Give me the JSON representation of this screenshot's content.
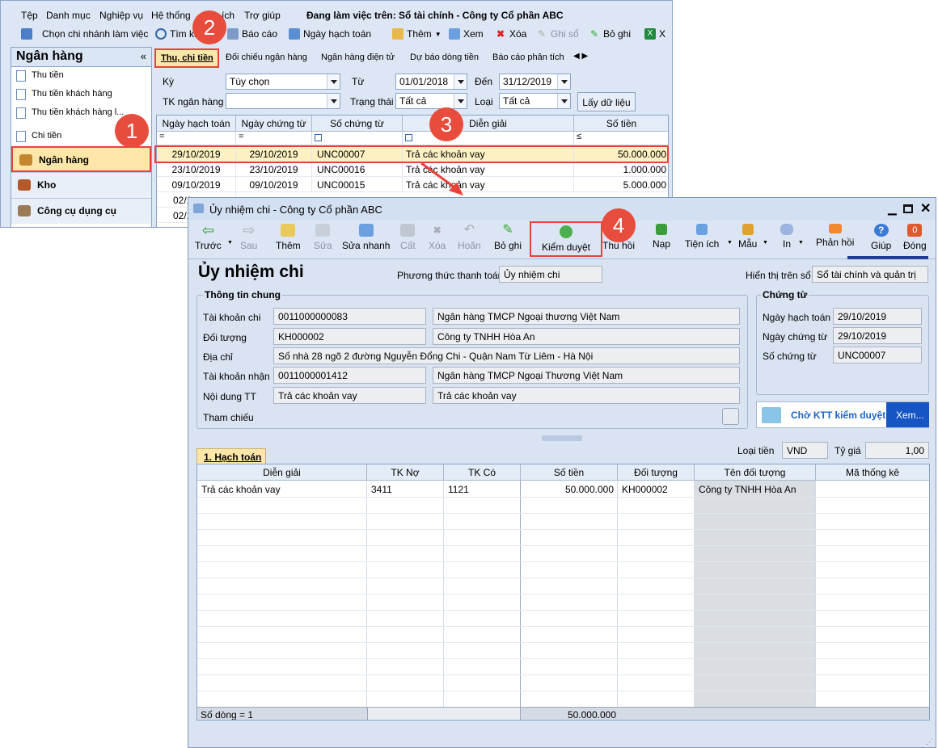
{
  "main": {
    "menu": [
      "Tệp",
      "Danh mục",
      "Nghiệp vụ",
      "Hệ thống",
      "ích",
      "Trợ giúp"
    ],
    "working_on": "Đang làm việc trên: Sổ tài chính - Công ty Cổ phần ABC",
    "toolbar": {
      "branch": "Chọn chi nhánh làm việc",
      "search": "Tìm ki",
      "report": "Báo cáo",
      "posting_date": "Ngày hạch toán",
      "add": "Thêm",
      "view": "Xem",
      "delete": "Xóa",
      "post_ledger": "Ghi sổ",
      "unpost": "Bỏ ghi",
      "excel": "X"
    },
    "left_panel": {
      "title": "Ngân hàng",
      "collapse": "«",
      "items": [
        "Thu tiền",
        "Thu tiền khách hàng",
        "Thu tiền khách hàng l...",
        "Chi tiền"
      ],
      "modules": [
        "Ngân hàng",
        "Kho",
        "Công cụ dụng cụ"
      ]
    },
    "tabs": [
      "Thu, chi tiền",
      "Đối chiếu ngân hàng",
      "Ngân hàng điện tử",
      "Dự báo dòng tiền",
      "Báo cáo phân tích"
    ],
    "filters": {
      "period_label": "Kỳ",
      "period_value": "Tùy chọn",
      "from_label": "Từ",
      "from_value": "01/01/2018",
      "to_label": "Đến",
      "to_value": "31/12/2019",
      "account_label": "TK ngân hàng",
      "account_value": "",
      "status_label": "Trạng thái",
      "status_value": "Tất cả",
      "type_label": "Loại",
      "type_value": "Tất cả",
      "fetch_button": "Lấy dữ liệu"
    },
    "grid": {
      "headers": [
        "Ngày hạch toán",
        "Ngày chứng từ",
        "Số chứng từ",
        "Diễn giải",
        "Số tiền"
      ],
      "filter_ops": [
        "=",
        "=",
        "",
        "",
        "≤"
      ],
      "rows": [
        [
          "29/10/2019",
          "29/10/2019",
          "UNC00007",
          "Trả các khoản vay",
          "50.000.000"
        ],
        [
          "23/10/2019",
          "23/10/2019",
          "UNC00016",
          "Trả các khoản vay",
          "1.000.000"
        ],
        [
          "09/10/2019",
          "09/10/2019",
          "UNC00015",
          "Trả các khoản vay",
          "5.000.000"
        ],
        [
          "02/1",
          "",
          "",
          "",
          ""
        ],
        [
          "02/1",
          "",
          "",
          "",
          ""
        ]
      ]
    }
  },
  "dialog": {
    "title": "Ủy nhiệm chi - Công ty Cổ phần ABC",
    "toolbar": [
      "Trước",
      "Sau",
      "Thêm",
      "Sửa",
      "Sửa nhanh",
      "Cất",
      "Xóa",
      "Hoãn",
      "Bỏ ghi",
      "Kiểm duyệt",
      "Thu hồi",
      "Nạp",
      "Tiện ích",
      "Mẫu",
      "In",
      "Phản hồi",
      "Giúp",
      "Đóng"
    ],
    "heading": "Ủy nhiệm chi",
    "payment_method_label": "Phương thức thanh toán",
    "payment_method_value": "Ủy nhiệm chi",
    "show_on_label": "Hiển thị trên sổ",
    "show_on_value": "Sổ tài chính và quản trị",
    "general_group": "Thông tin chung",
    "pay_account_label": "Tài khoản chi",
    "pay_account": "0011000000083",
    "pay_bank": "Ngân hàng TMCP Ngoại thương Việt Nam",
    "object_label": "Đối tượng",
    "object_code": "KH000002",
    "object_name": "Công ty TNHH Hòa An",
    "address_label": "Địa chỉ",
    "address": "Số nhà 28 ngõ 2 đường Nguyễn Đổng Chi - Quận Nam Từ Liêm - Hà Nội",
    "recv_account_label": "Tài khoản nhận",
    "recv_account": "0011000001412",
    "recv_bank": "Ngân hàng TMCP Ngoại Thương Việt Nam",
    "content_label": "Nội dung TT",
    "content": "Trả các khoản vay",
    "content2": "Trả các khoản vay",
    "reference_label": "Tham chiếu",
    "voucher_group": "Chứng từ",
    "posting_date_label": "Ngày hạch toán",
    "posting_date": "29/10/2019",
    "voucher_date_label": "Ngày chứng từ",
    "voucher_date": "29/10/2019",
    "voucher_no_label": "Số chứng từ",
    "voucher_no": "UNC00007",
    "approval_status": "Chờ KTT kiểm duyệt",
    "approval_view": "Xem...",
    "tab_accounting": "1. Hạch toán",
    "currency_label": "Loại tiền",
    "currency": "VND",
    "rate_label": "Tỷ giá",
    "rate": "1,00",
    "grid_headers": [
      "Diễn giải",
      "TK Nợ",
      "TK Có",
      "Số tiền",
      "Đối tượng",
      "Tên đối tượng",
      "Mã thống kê"
    ],
    "grid_row": [
      "Trả các khoản vay",
      "3411",
      "1121",
      "50.000.000",
      "KH000002",
      "Công ty TNHH Hòa An",
      ""
    ],
    "footer_count": "Số dòng = 1",
    "footer_total": "50.000.000"
  },
  "callouts": [
    "1",
    "2",
    "3",
    "4"
  ],
  "colors": {
    "highlight": "#fdf0c2",
    "callout": "#e84c3d",
    "approval": "#0a57c8"
  }
}
